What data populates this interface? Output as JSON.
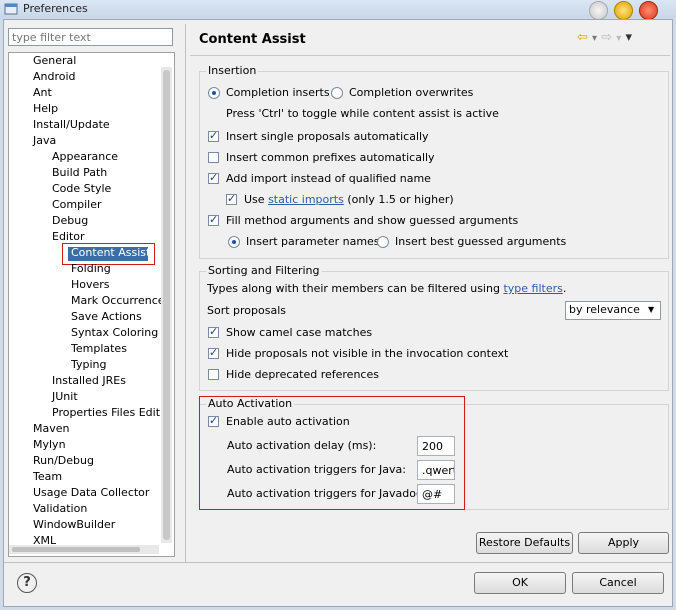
{
  "window": {
    "title": "Preferences"
  },
  "filter": {
    "placeholder": "type filter text"
  },
  "tree": [
    {
      "label": "General"
    },
    {
      "label": "Android"
    },
    {
      "label": "Ant"
    },
    {
      "label": "Help"
    },
    {
      "label": "Install/Update"
    },
    {
      "label": "Java"
    },
    {
      "label": "Appearance"
    },
    {
      "label": "Build Path"
    },
    {
      "label": "Code Style"
    },
    {
      "label": "Compiler"
    },
    {
      "label": "Debug"
    },
    {
      "label": "Editor"
    },
    {
      "label": "Content Assist"
    },
    {
      "label": "Folding"
    },
    {
      "label": "Hovers"
    },
    {
      "label": "Mark Occurrences"
    },
    {
      "label": "Save Actions"
    },
    {
      "label": "Syntax Coloring"
    },
    {
      "label": "Templates"
    },
    {
      "label": "Typing"
    },
    {
      "label": "Installed JREs"
    },
    {
      "label": "JUnit"
    },
    {
      "label": "Properties Files Edito"
    },
    {
      "label": "Maven"
    },
    {
      "label": "Mylyn"
    },
    {
      "label": "Run/Debug"
    },
    {
      "label": "Team"
    },
    {
      "label": "Usage Data Collector"
    },
    {
      "label": "Validation"
    },
    {
      "label": "WindowBuilder"
    },
    {
      "label": "XML"
    }
  ],
  "page": {
    "title": "Content Assist"
  },
  "insertion": {
    "label": "Insertion",
    "completion_inserts": "Completion inserts",
    "completion_overwrites": "Completion overwrites",
    "toggle_hint": "Press 'Ctrl' to toggle while content assist is active",
    "insert_single": "Insert single proposals automatically",
    "insert_common": "Insert common prefixes automatically",
    "add_import": "Add import instead of qualified name",
    "use_prefix": "Use",
    "static_imports": "static imports",
    "use_suffix": "(only 1.5 or higher)",
    "fill_method": "Fill method arguments and show guessed arguments",
    "insert_param_names": "Insert parameter names",
    "insert_best_guessed": "Insert best guessed arguments"
  },
  "sorting": {
    "label": "Sorting and Filtering",
    "types_text": "Types along with their members can be filtered using",
    "type_filters": "type filters",
    "period": ".",
    "sort_proposals": "Sort proposals",
    "sort_value": "by relevance",
    "camel_case": "Show camel case matches",
    "hide_not_visible": "Hide proposals not visible in the invocation context",
    "hide_deprecated": "Hide deprecated references"
  },
  "auto": {
    "label": "Auto Activation",
    "enable": "Enable auto activation",
    "delay_label": "Auto activation delay (ms):",
    "delay_value": "200",
    "java_label": "Auto activation triggers for Java:",
    "java_value": ".qwert",
    "javadoc_label": "Auto activation triggers for Javadoc:",
    "javadoc_value": "@#"
  },
  "buttons": {
    "restore_defaults": "Restore Defaults",
    "apply": "Apply",
    "ok": "OK",
    "cancel": "Cancel"
  },
  "icons": {
    "help": "?",
    "nav_back": "⇦",
    "nav_forward": "⇨",
    "menu": "▾"
  }
}
